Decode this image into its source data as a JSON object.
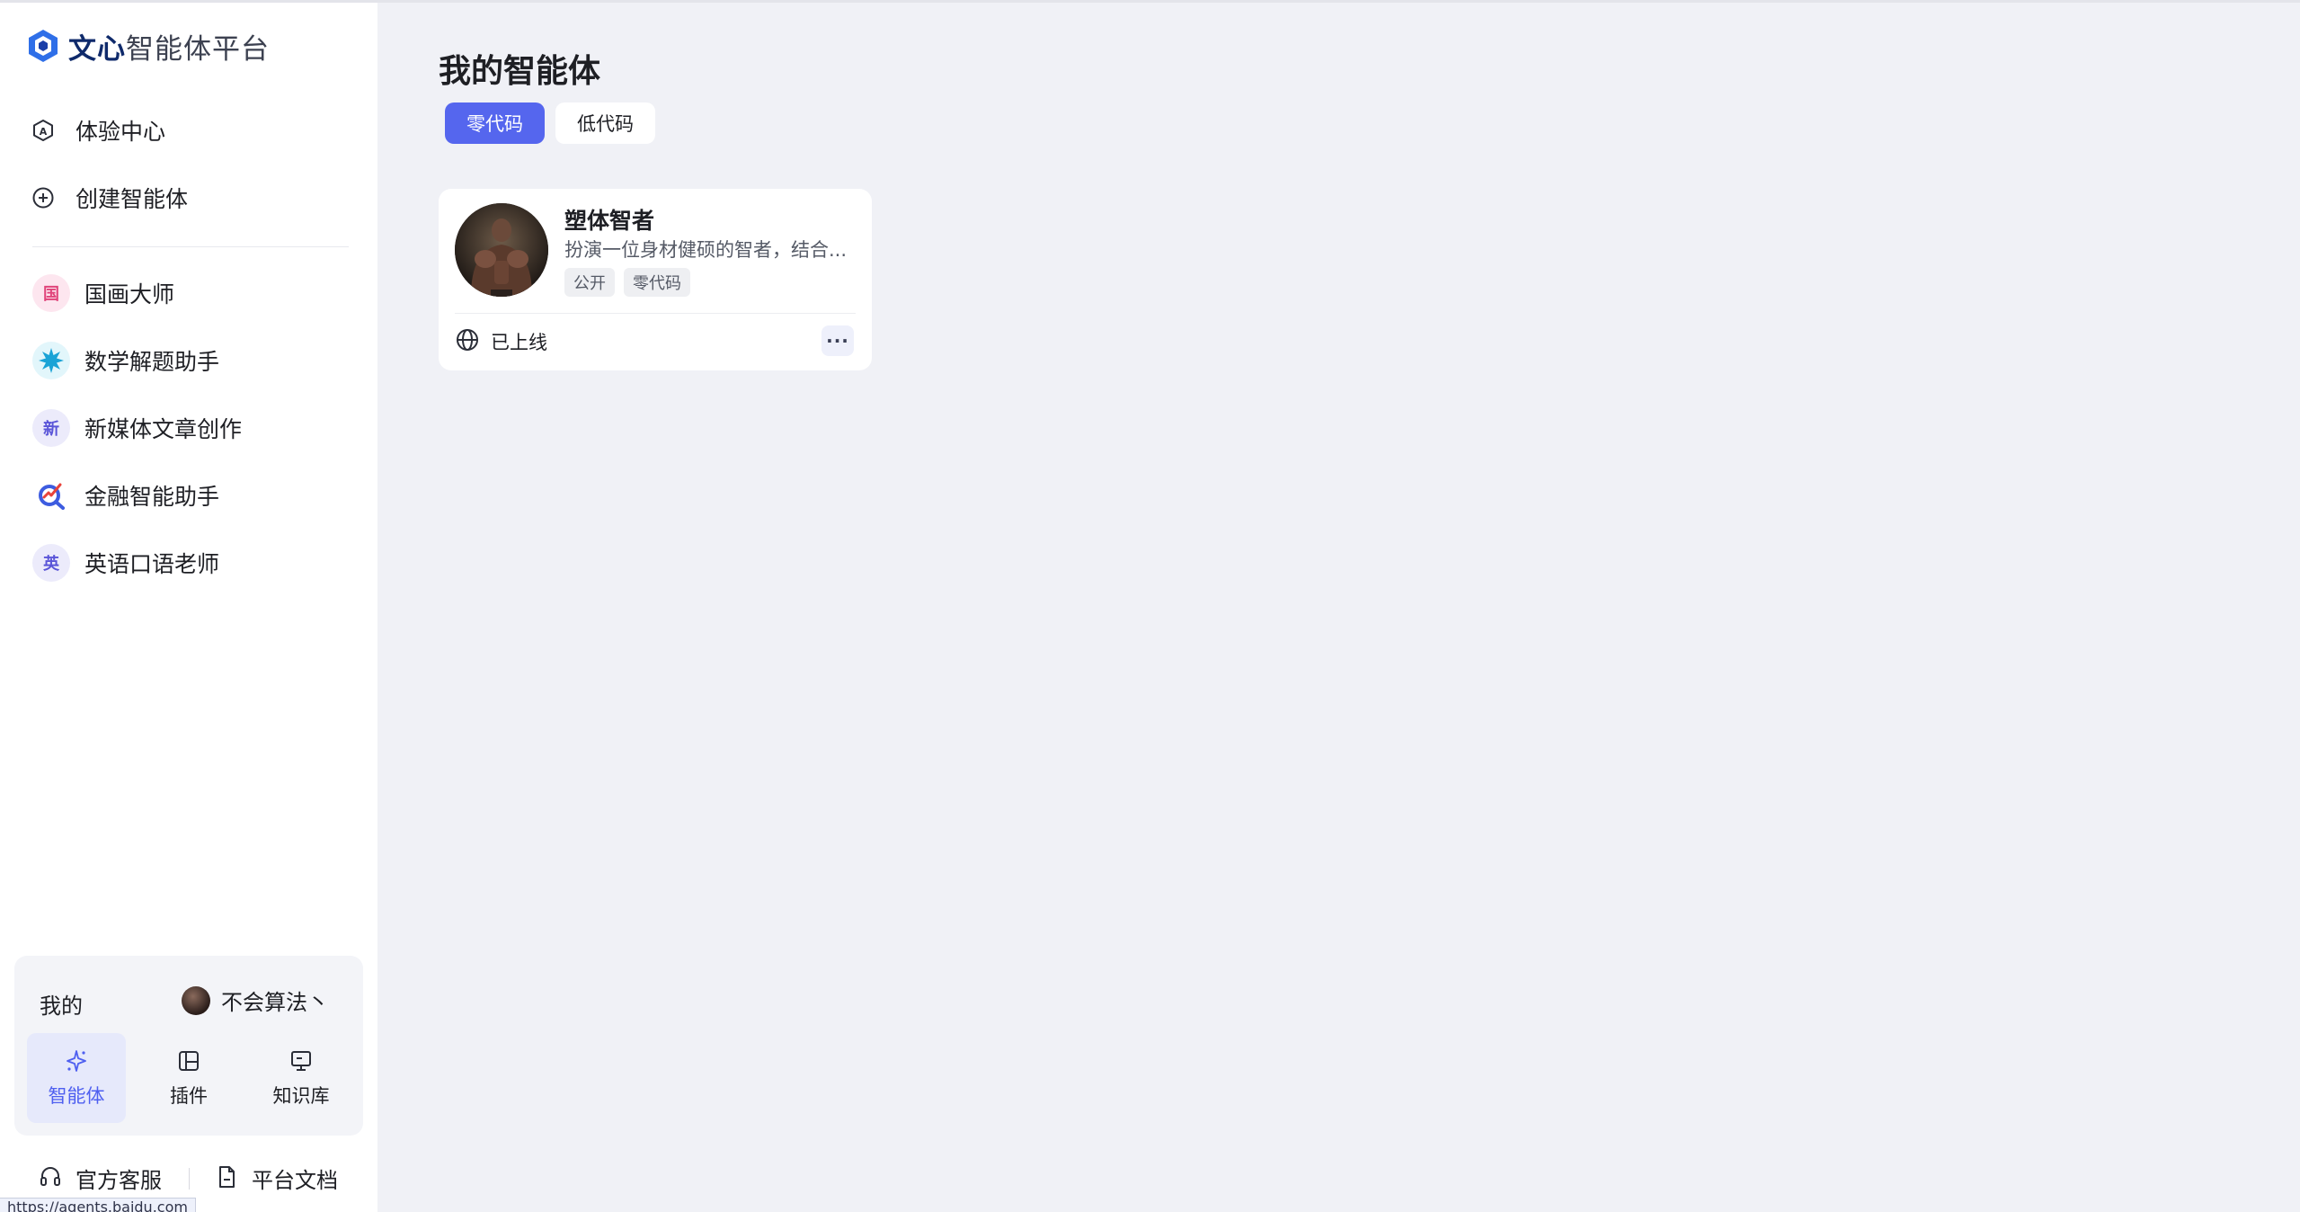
{
  "app": {
    "brand": "文心",
    "brand_suffix": "智能体平台"
  },
  "sidebar": {
    "nav": [
      {
        "label": "体验中心",
        "icon": "experience-center-icon"
      },
      {
        "label": "创建智能体",
        "icon": "plus-circle-icon"
      }
    ],
    "agents": [
      {
        "label": "国画大师",
        "avatar_text": "国",
        "bg": "#fde6ef",
        "fg": "#e0457b"
      },
      {
        "label": "数学解题助手",
        "avatar_text": "",
        "bg": "#e2f6fb",
        "fg": "#1aa3d6"
      },
      {
        "label": "新媒体文章创作",
        "avatar_text": "新",
        "bg": "#ecebfb",
        "fg": "#5a55d8"
      },
      {
        "label": "金融智能助手",
        "avatar_text": "",
        "bg": "#ffffff",
        "fg": "#3d5ce0"
      },
      {
        "label": "英语口语老师",
        "avatar_text": "英",
        "bg": "#ecebfb",
        "fg": "#5a55d8"
      }
    ],
    "mine": {
      "title": "我的",
      "user_name": "不会算法丶",
      "tabs": [
        {
          "label": "智能体",
          "icon": "sparkle-icon",
          "active": true
        },
        {
          "label": "插件",
          "icon": "plugin-icon",
          "active": false
        },
        {
          "label": "知识库",
          "icon": "knowledge-base-icon",
          "active": false
        }
      ]
    },
    "footer": {
      "support_label": "官方客服",
      "docs_label": "平台文档"
    },
    "status_url": "https://agents.baidu.com"
  },
  "main": {
    "title": "我的智能体",
    "tabs": [
      {
        "label": "零代码",
        "active": true
      },
      {
        "label": "低代码",
        "active": false
      }
    ],
    "cards": [
      {
        "name": "塑体智者",
        "description": "扮演一位身材健硕的智者，结合...",
        "tags": [
          "公开",
          "零代码"
        ],
        "status": "已上线"
      }
    ]
  },
  "colors": {
    "accent": "#5566ee",
    "page_bg": "#f0f1f6",
    "sidebar_bg": "#ffffff"
  }
}
